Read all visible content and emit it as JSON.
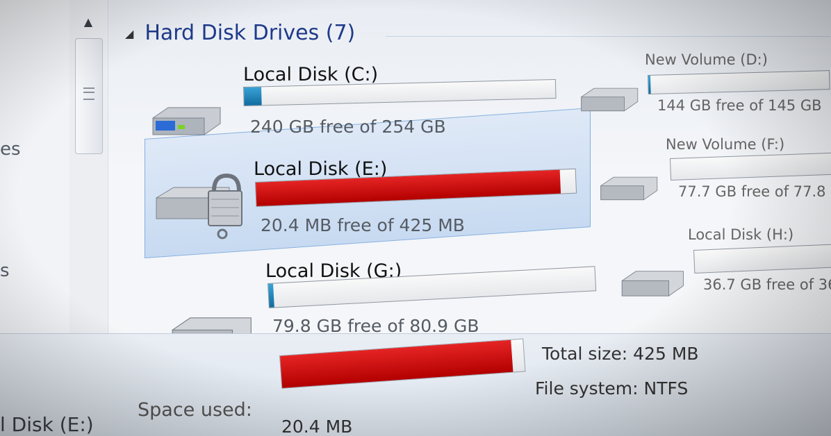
{
  "nav": {
    "item_1_fragment": "es",
    "item_2_fragment": "s"
  },
  "section": {
    "title": "Hard Disk Drives (7)"
  },
  "drives": [
    {
      "name": "Local Disk (C:)",
      "free_text": "240 GB free of 254 GB",
      "used_fraction": 0.055,
      "fill_color": "#1f8ac0",
      "icon": "windows-drive-icon"
    },
    {
      "name": "Local Disk (E:)",
      "free_text": "20.4 MB free of 425 MB",
      "used_fraction": 0.952,
      "fill_color": "#d00000",
      "icon": "locked-drive-icon",
      "selected": true
    },
    {
      "name": "Local Disk (G:)",
      "free_text": "79.8 GB free of 80.9 GB",
      "used_fraction": 0.014,
      "fill_color": "#1f8ac0",
      "icon": "drive-icon"
    },
    {
      "name": "New Volume (D:)",
      "free_text": "144 GB free of 145 GB",
      "used_fraction": 0.01,
      "fill_color": "#1f8ac0",
      "icon": "drive-icon"
    },
    {
      "name": "New Volume (F:)",
      "free_text": "77.7 GB free of 77.8 GB",
      "used_fraction": 0.0,
      "fill_color": "#1f8ac0",
      "icon": "drive-icon"
    },
    {
      "name": "Local Disk (H:)",
      "free_text": "36.7 GB free of 36",
      "used_fraction": 0.0,
      "fill_color": "#1f8ac0",
      "icon": "drive-icon"
    }
  ],
  "details": {
    "title": "l Disk (E:)",
    "space_used_label": "Space used:",
    "space_used_value": "20.4 MB",
    "space_used_fraction": 0.952,
    "total_size": "Total size:  425 MB",
    "file_system": "File system:  NTFS"
  },
  "colors": {
    "header_text": "#1e3a8a",
    "selection_bg": "#c7daf1",
    "bar_red": "#d00000",
    "bar_blue": "#1f8ac0"
  }
}
